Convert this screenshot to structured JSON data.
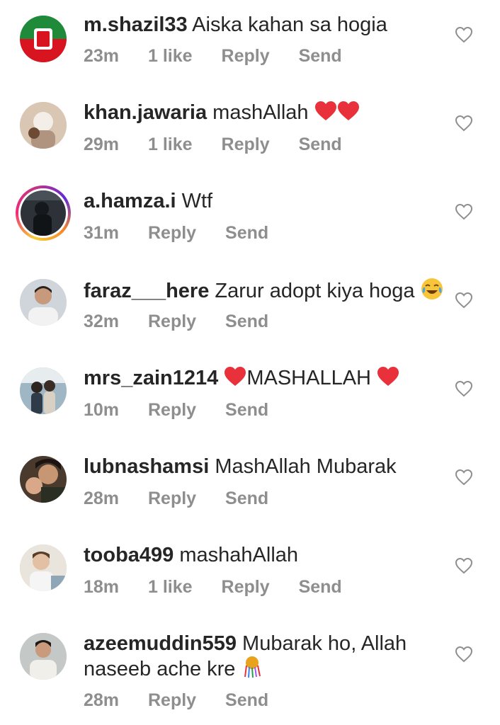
{
  "comments": [
    {
      "username": "m.shazil33",
      "text": "Aiska kahan sa hogia",
      "emoji": [],
      "time": "23m",
      "likes": "1 like",
      "reply": "Reply",
      "send": "Send"
    },
    {
      "username": "khan.jawaria",
      "text": "mashAllah",
      "emoji": [
        "red-heart",
        "red-heart"
      ],
      "time": "29m",
      "likes": "1 like",
      "reply": "Reply",
      "send": "Send"
    },
    {
      "username": "a.hamza.i",
      "text": "Wtf",
      "emoji": [],
      "time": "31m",
      "likes": "",
      "reply": "Reply",
      "send": "Send"
    },
    {
      "username": "faraz___here",
      "text": "Zarur adopt kiya hoga",
      "emoji": [
        "tears-of-joy"
      ],
      "time": "32m",
      "likes": "",
      "reply": "Reply",
      "send": "Send"
    },
    {
      "username": "mrs_zain1214",
      "text_before": "",
      "text": "MASHALLAH",
      "emoji": [
        "red-heart",
        "red-heart"
      ],
      "time": "10m",
      "likes": "",
      "reply": "Reply",
      "send": "Send"
    },
    {
      "username": "lubnashamsi",
      "text": "MashAllah Mubarak",
      "emoji": [],
      "time": "28m",
      "likes": "",
      "reply": "Reply",
      "send": "Send"
    },
    {
      "username": "tooba499",
      "text": "mashahAllah",
      "emoji": [],
      "time": "18m",
      "likes": "1 like",
      "reply": "Reply",
      "send": "Send"
    },
    {
      "username": "azeemuddin559",
      "text": "Mubarak ho, Allah naseeb ache kre",
      "emoji": [
        "confetti"
      ],
      "time": "28m",
      "likes": "",
      "reply": "Reply",
      "send": "Send"
    }
  ],
  "colors": {
    "text": "#262626",
    "meta": "#8e8e8e",
    "heart_outline": "#8e8e8e",
    "emoji_heart": "#e8313b"
  }
}
